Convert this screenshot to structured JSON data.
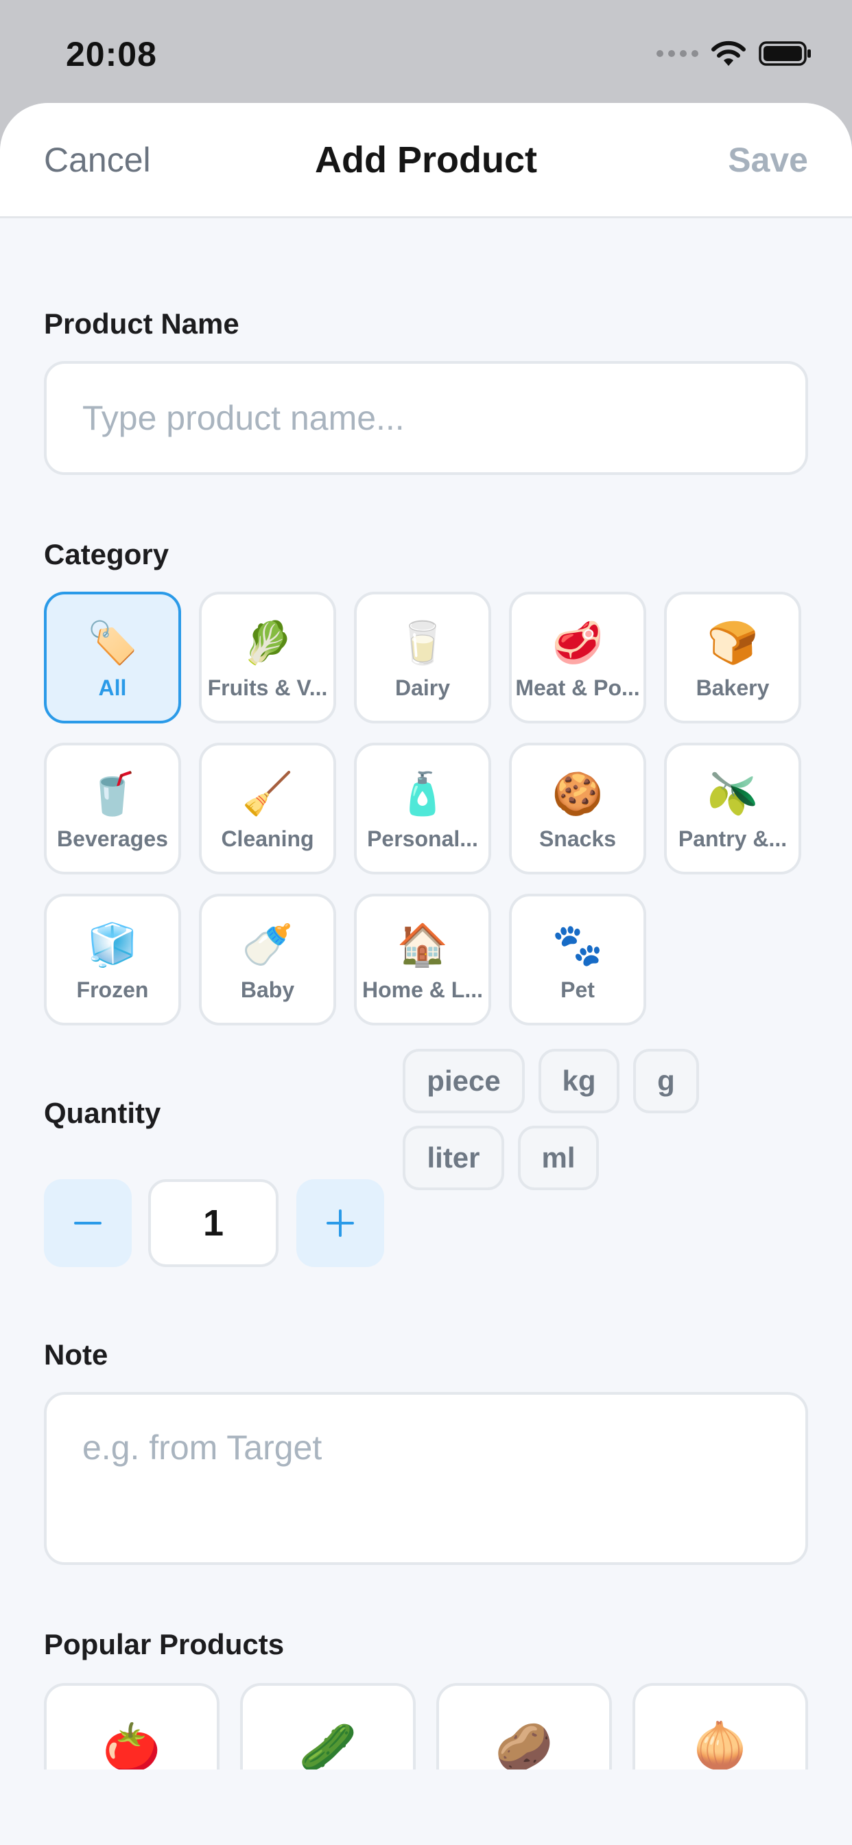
{
  "status_bar": {
    "time": "20:08"
  },
  "nav": {
    "cancel": "Cancel",
    "title": "Add Product",
    "save": "Save"
  },
  "product_name": {
    "label": "Product Name",
    "placeholder": "Type product name..."
  },
  "category": {
    "label": "Category",
    "items": [
      {
        "label": "All",
        "emoji": "🏷️",
        "selected": true
      },
      {
        "label": "Fruits & V...",
        "emoji": "🥬"
      },
      {
        "label": "Dairy",
        "emoji": "🥛"
      },
      {
        "label": "Meat & Po...",
        "emoji": "🥩"
      },
      {
        "label": "Bakery",
        "emoji": "🍞"
      },
      {
        "label": "Beverages",
        "emoji": "🥤"
      },
      {
        "label": "Cleaning",
        "emoji": "🧹"
      },
      {
        "label": "Personal...",
        "emoji": "🧴"
      },
      {
        "label": "Snacks",
        "emoji": "🍪"
      },
      {
        "label": "Pantry &...",
        "emoji": "🫒"
      },
      {
        "label": "Frozen",
        "emoji": "🧊"
      },
      {
        "label": "Baby",
        "emoji": "🍼"
      },
      {
        "label": "Home & L...",
        "emoji": "🏠"
      },
      {
        "label": "Pet",
        "emoji": "🐾"
      }
    ]
  },
  "quantity": {
    "label": "Quantity",
    "value": "1",
    "units": [
      "piece",
      "kg",
      "g",
      "liter",
      "ml"
    ]
  },
  "note": {
    "label": "Note",
    "placeholder": "e.g. from Target"
  },
  "popular": {
    "label": "Popular Products",
    "items": [
      {
        "emoji": "🍅"
      },
      {
        "emoji": "🥒"
      },
      {
        "emoji": "🥔"
      },
      {
        "emoji": "🧅"
      }
    ]
  },
  "colors": {
    "accent": "#2a9ae8",
    "save_disabled": "#a6b1bd"
  }
}
